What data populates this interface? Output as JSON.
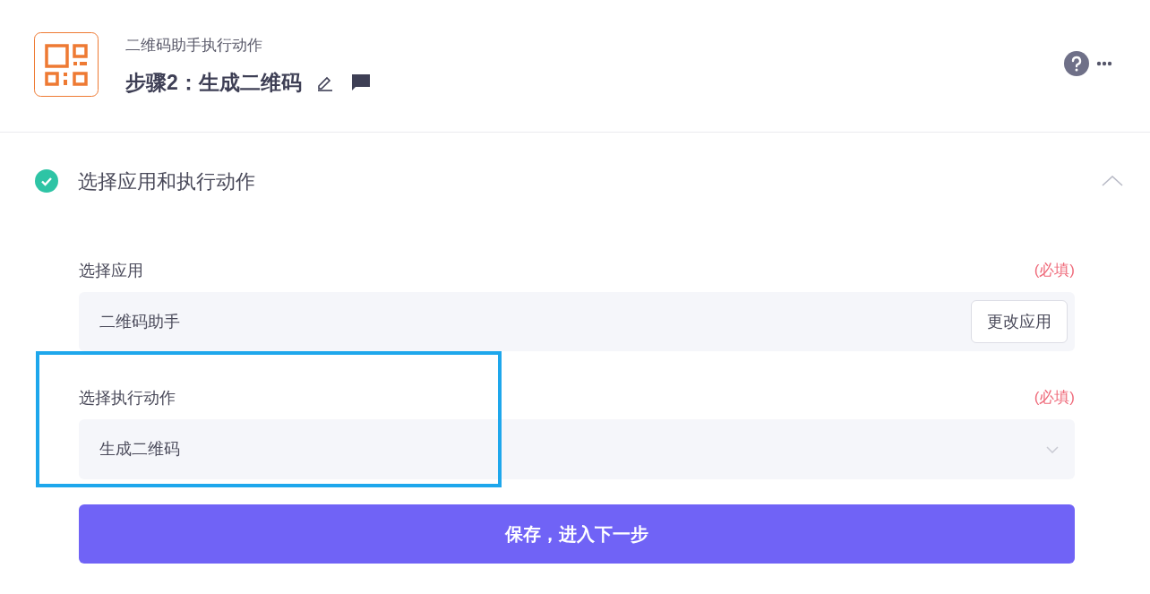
{
  "header": {
    "subtitle": "二维码助手执行动作",
    "title": "步骤2：生成二维码"
  },
  "section": {
    "title": "选择应用和执行动作",
    "completed": true,
    "expanded": true,
    "fields": [
      {
        "kind": "app",
        "label": "选择应用",
        "required_note": "(必填)",
        "value": "二维码助手",
        "button": "更改应用",
        "highlighted": false
      },
      {
        "kind": "select",
        "label": "选择执行动作",
        "required_note": "(必填)",
        "value": "生成二维码",
        "highlighted": true
      }
    ],
    "submit": "保存，进入下一步"
  }
}
